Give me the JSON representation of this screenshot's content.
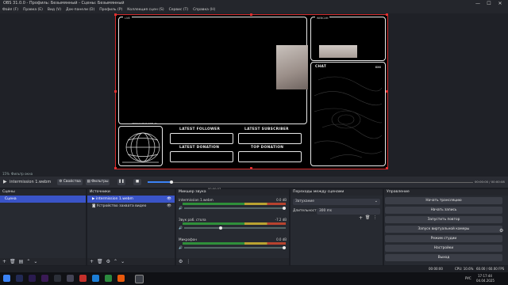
{
  "window": {
    "title": "OBS 31.0.0 - Профиль: Безымянный - Сцены: Безымянный",
    "minimize": "—",
    "maximize": "☐",
    "close": "✕"
  },
  "menu": [
    "Файл (F)",
    "Правка (E)",
    "Вид (V)",
    "Док-панели (D)",
    "Профиль (P)",
    "Коллекция сцен (S)",
    "Сервис (T)",
    "Справка (H)"
  ],
  "overlay": {
    "live_tag": "LIVE",
    "webcam_tag": "WEBCAM",
    "chat_title": "CHAT",
    "chat_mark": "XXX",
    "boxes": [
      "LATEST FOLLOWER",
      "LATEST SUBSCRIBER",
      "LATEST DONATION",
      "TOP DONATION"
    ],
    "small_text": "WWW.YOURCHANNEL.TV"
  },
  "scene_strip": {
    "left": "15%",
    "hint": "Фильтр окна"
  },
  "media": {
    "file": "intermission 1.webm",
    "props_btn": "Свойства",
    "filters_btn": "Фильтры",
    "time_center": "00:00:07",
    "time_right": "00:00:00 / 00:00:08"
  },
  "docks": {
    "scenes": {
      "title": "Сцены",
      "items": [
        "Сцена"
      ]
    },
    "sources": {
      "title": "Источники",
      "items": [
        "intermission 1.webm",
        "Устройство захвата видео"
      ]
    },
    "mixer": {
      "title": "Микшер звука",
      "channels": [
        {
          "name": "intermission 1.webm",
          "db": "0.0 dB"
        },
        {
          "name": "Звук раб. стола",
          "db": "-7.2 dB"
        },
        {
          "name": "Микрофон",
          "db": "0.0 dB"
        }
      ],
      "scale": [
        "-60",
        "-55",
        "-50",
        "-45",
        "-40",
        "-35",
        "-30",
        "-25",
        "-20",
        "-15",
        "-10",
        "-5",
        "0"
      ]
    },
    "transitions": {
      "title": "Переходы между сценами",
      "selected": "Затухание",
      "duration_label": "Длительность",
      "duration_value": "300 ms"
    },
    "controls": {
      "title": "Управление",
      "buttons": [
        "Начать трансляцию",
        "Начать запись",
        "Запустить повтор",
        "Запуск виртуальной камеры",
        "Режим студии",
        "Настройки",
        "Выход"
      ]
    }
  },
  "status": {
    "cpu": "CPU: 10.6%",
    "fps": "60.00 / 60.00 FPS",
    "timer": "00:00:00"
  },
  "taskbar": {
    "lang": "РУС",
    "time": "17:17:44",
    "date": "04.04.2025"
  },
  "colors": {
    "selection": "#3a54c8",
    "canvas_outline": "#d42a2a",
    "accent_blue": "#3b83f6"
  }
}
